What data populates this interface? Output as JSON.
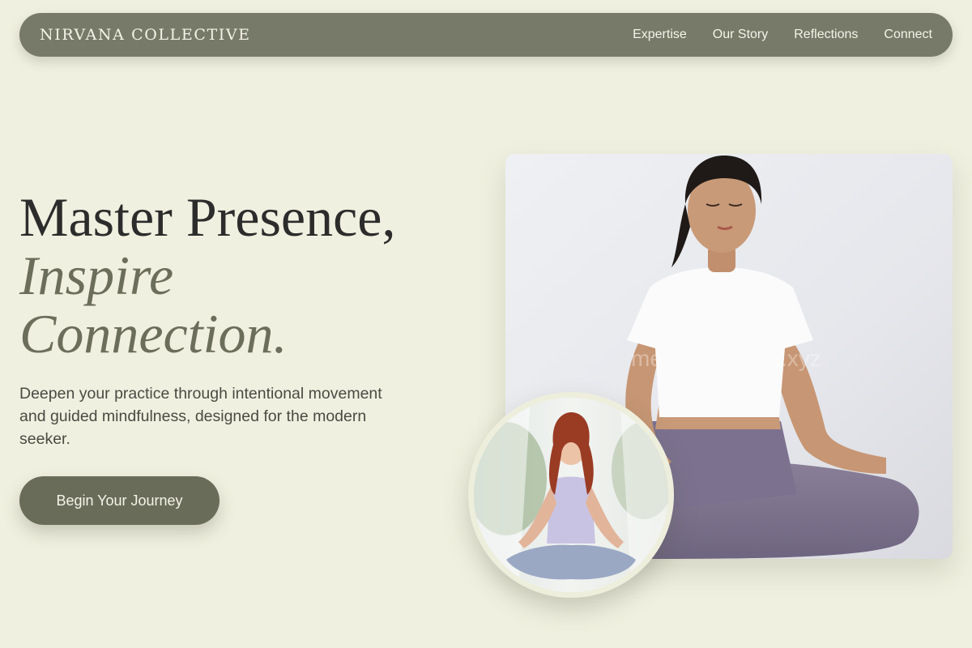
{
  "nav": {
    "brand": "NIRVANA COLLECTIVE",
    "links": [
      "Expertise",
      "Our Story",
      "Reflections",
      "Connect"
    ]
  },
  "hero": {
    "title_line1": "Master Presence,",
    "title_accent_line2": "Inspire",
    "title_accent_line3": "Connection.",
    "description": "Deepen your practice through intentional movement and guided mindfulness, designed for the modern seeker.",
    "cta_label": "Begin Your Journey"
  },
  "images": {
    "main": "woman-meditating-lotus-pose-photo",
    "inset": "redhead-woman-meditating-outdoors-photo"
  },
  "colors": {
    "background": "#f0f0e0",
    "nav_bg": "#777a68",
    "accent_text": "#6b6e5a",
    "cta_bg": "#6a6c5a",
    "heading_text": "#2c2c2c"
  }
}
